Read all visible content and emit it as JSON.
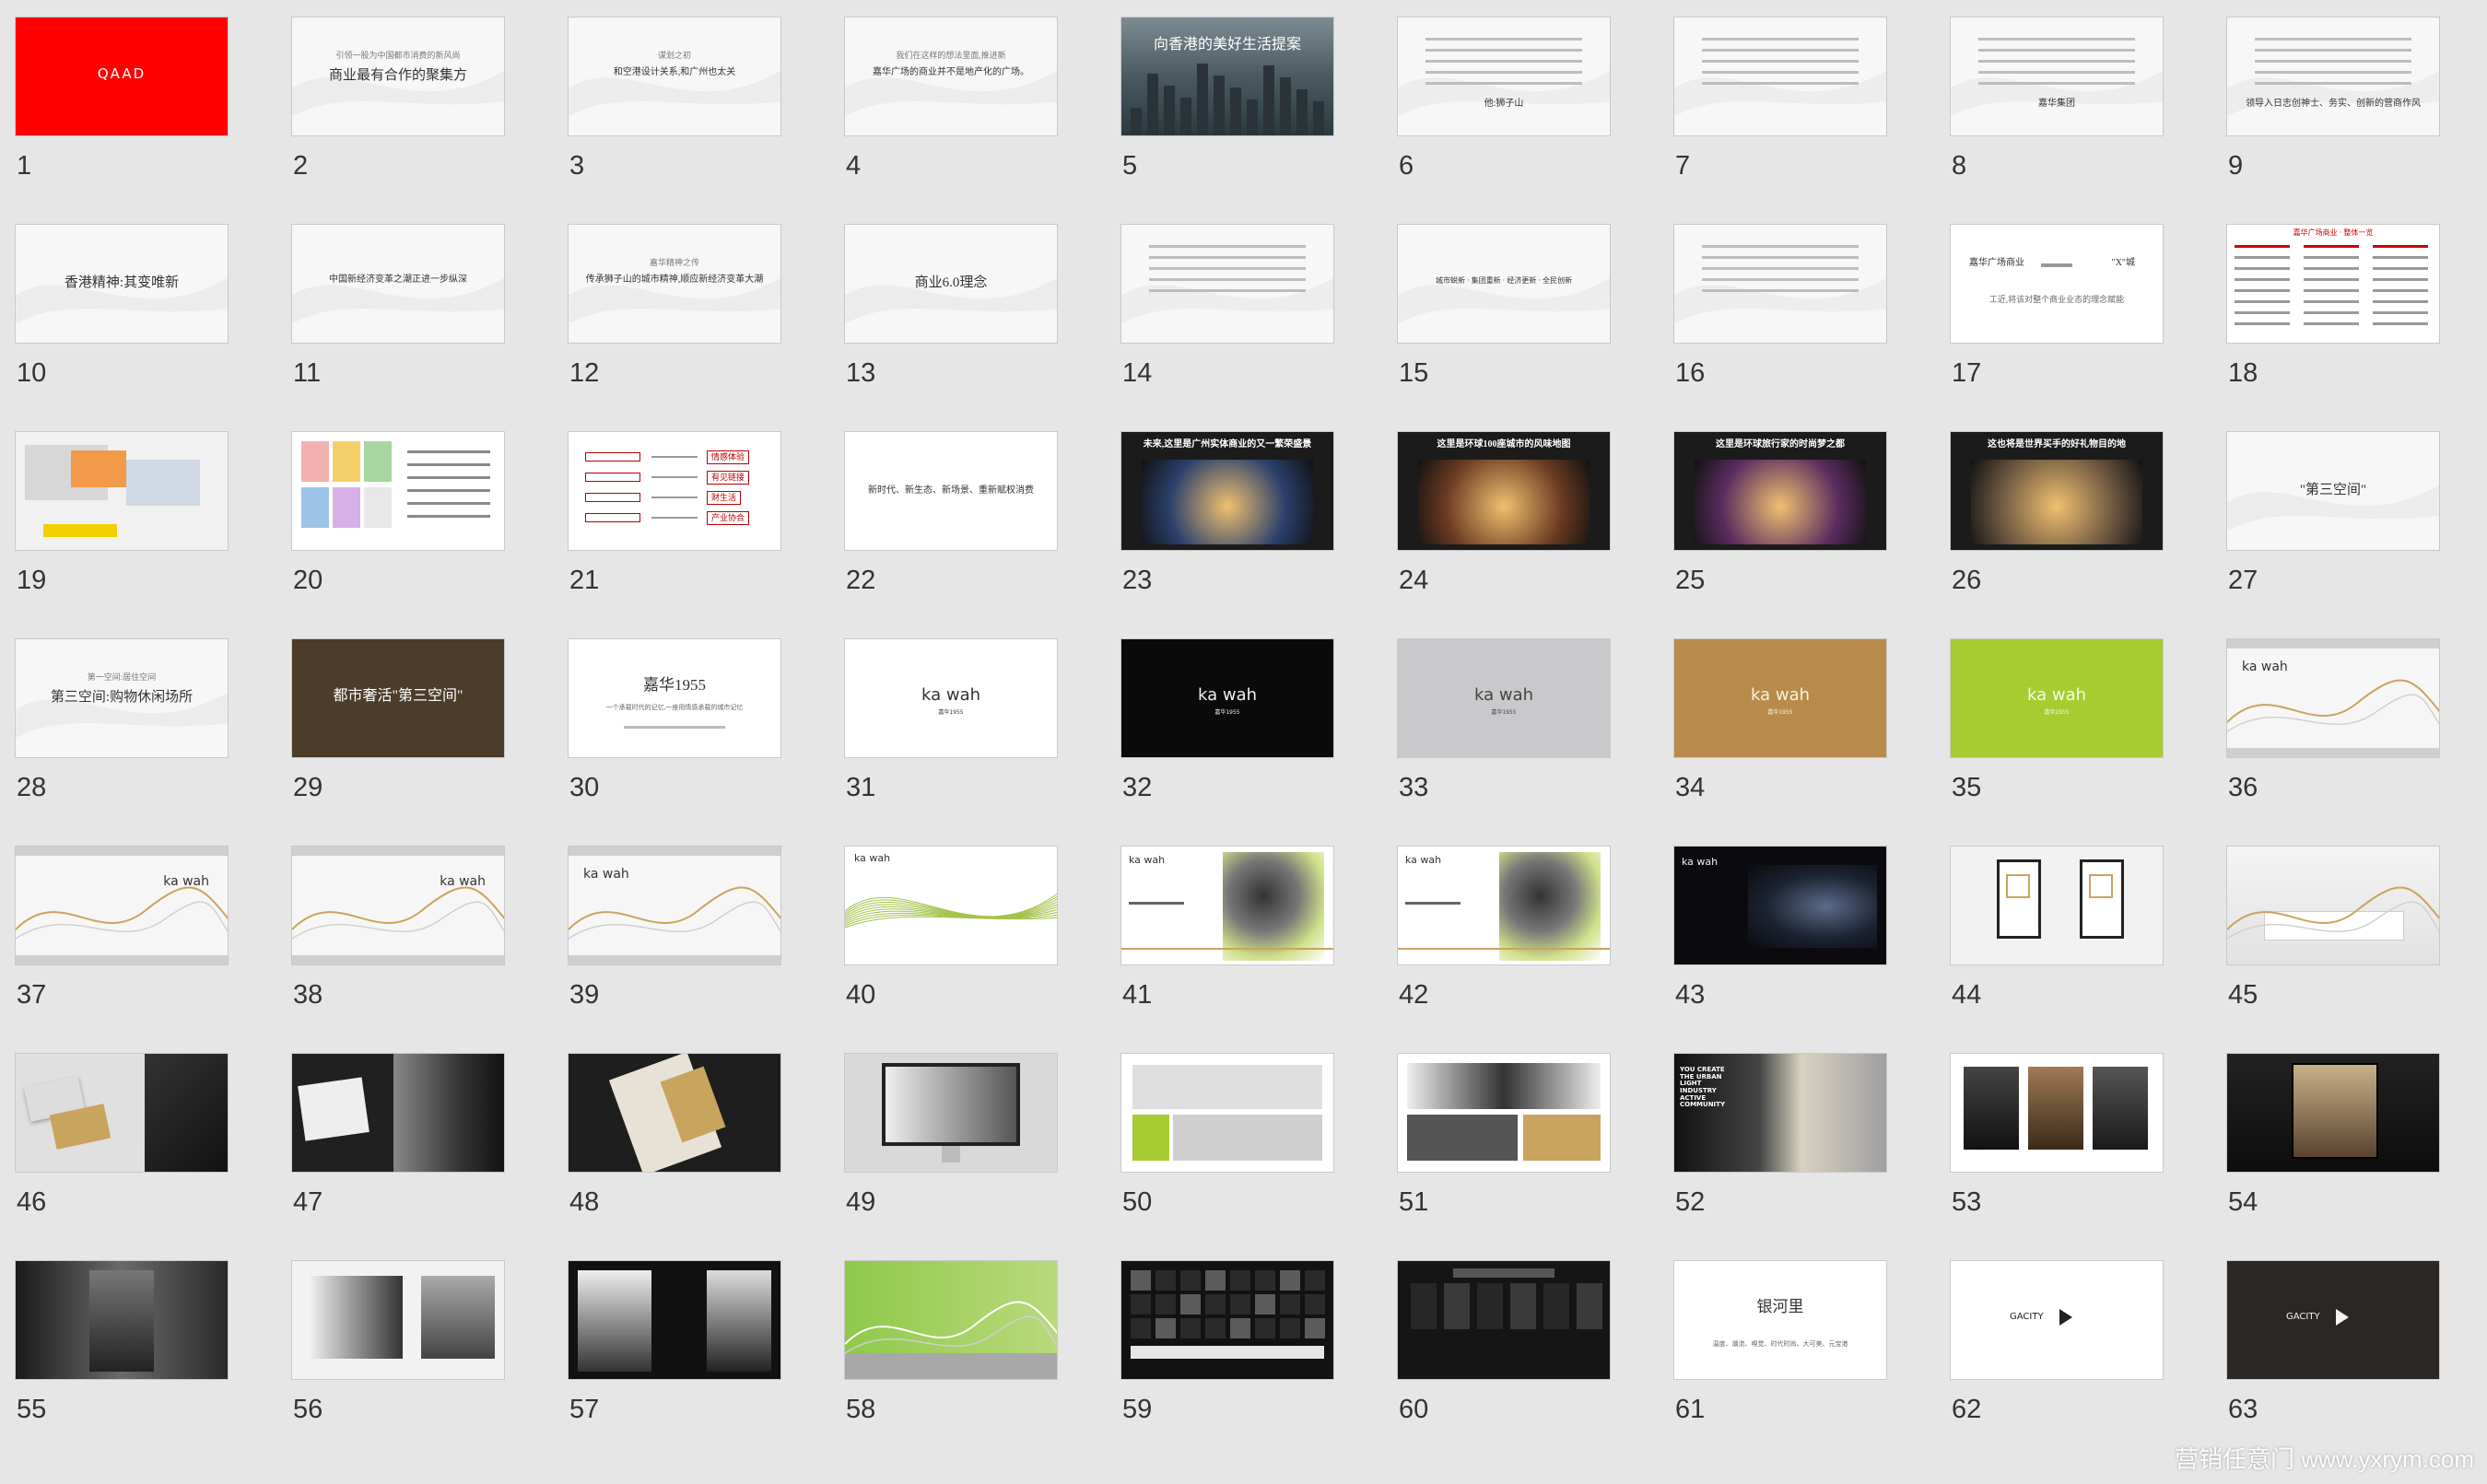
{
  "slides": [
    {
      "num": "1",
      "v": "red_logo",
      "logo": "QAAD",
      "bg": "#ff0000"
    },
    {
      "num": "2",
      "v": "wave",
      "sub": "引领一股为中国都市消费的新风尚",
      "title": "商业最有合作的聚集方"
    },
    {
      "num": "3",
      "v": "wave",
      "sub": "谋划之初",
      "title": "和空港设计关系,和广州也太关"
    },
    {
      "num": "4",
      "v": "wave",
      "sub": "我们在这样的想法里面,推进新",
      "title": "嘉华广场的商业并不是地产化的广场。"
    },
    {
      "num": "5",
      "v": "city",
      "title": "向香港的美好生活提案",
      "bg": "#3a4a55"
    },
    {
      "num": "6",
      "v": "wave_text",
      "title": "他:狮子山"
    },
    {
      "num": "7",
      "v": "wave_text",
      "title": ""
    },
    {
      "num": "8",
      "v": "wave_text",
      "title": "嘉华集团"
    },
    {
      "num": "9",
      "v": "wave_text",
      "title": "领导入日志创神士、务实、创新的营商作风"
    },
    {
      "num": "10",
      "v": "wave",
      "sub": "",
      "title": "香港精神:其变唯新"
    },
    {
      "num": "11",
      "v": "wave",
      "sub": "",
      "title": "中国新经济变革之潮正进一步纵深"
    },
    {
      "num": "12",
      "v": "wave",
      "sub": "嘉华精神之传",
      "title": "传承狮子山的城市精神,顺应新经济变革大潮"
    },
    {
      "num": "13",
      "v": "wave",
      "sub": "",
      "title": "商业6.0理念"
    },
    {
      "num": "14",
      "v": "wave_text",
      "title": ""
    },
    {
      "num": "15",
      "v": "wave_list",
      "title": "城市蜕新 · 集团重新 · 经济更新 · 全民创新"
    },
    {
      "num": "16",
      "v": "wave_text",
      "title": ""
    },
    {
      "num": "17",
      "v": "arrow",
      "left": "嘉华广场商业",
      "right": "\"X\"城",
      "title": "工近,将该对整个商业业态的理念赋能"
    },
    {
      "num": "18",
      "v": "table",
      "title": "嘉华广场商业 · 整体一览"
    },
    {
      "num": "19",
      "v": "map",
      "title": ""
    },
    {
      "num": "20",
      "v": "plan",
      "title": ""
    },
    {
      "num": "21",
      "v": "flow",
      "labels": [
        "情感体验",
        "有见链接",
        "财生活",
        "产业协合"
      ]
    },
    {
      "num": "22",
      "v": "plain",
      "title": "新时代、新生态、新场景、重新赋权消费"
    },
    {
      "num": "23",
      "v": "dark_photo",
      "title": "未来,这里是广州实体商业的又一繁荣盛景",
      "photo": "#2a3f6b"
    },
    {
      "num": "24",
      "v": "dark_photo",
      "title": "这里是环球100座城市的风味地图",
      "photo": "#6b3a22"
    },
    {
      "num": "25",
      "v": "dark_photo",
      "title": "这里是环球旅行家的时尚梦之都",
      "photo": "#5a2c5f"
    },
    {
      "num": "26",
      "v": "dark_photo",
      "title": "这也将是世界买手的好礼物目的地",
      "photo": "#6a5540"
    },
    {
      "num": "27",
      "v": "wave",
      "sub": "",
      "title": "\"第三空间\""
    },
    {
      "num": "28",
      "v": "wave",
      "sub": "第一空间:居住空间",
      "title": "第三空间:购物休闲场所"
    },
    {
      "num": "29",
      "v": "brown",
      "title": "都市奢活\"第三空间\"",
      "bg": "#4c3c2a"
    },
    {
      "num": "30",
      "v": "plain2",
      "title": "嘉华1955",
      "sub": "一个承载时代的记忆,一座用情感承载的城市记忆"
    },
    {
      "num": "31",
      "v": "logo",
      "bg": "#ffffff",
      "fg": "#333333",
      "logo": "ka wah",
      "tag": "嘉华1955"
    },
    {
      "num": "32",
      "v": "logo",
      "bg": "#0a0a0a",
      "fg": "#f0f0f0",
      "logo": "ka wah",
      "tag": "嘉华1955"
    },
    {
      "num": "33",
      "v": "logo",
      "bg": "#c9c9cc",
      "fg": "#444444",
      "logo": "ka wah",
      "tag": "嘉华1955"
    },
    {
      "num": "34",
      "v": "logo",
      "bg": "#b88b4a",
      "fg": "#f7f1e6",
      "logo": "ka wah",
      "tag": "嘉华1955"
    },
    {
      "num": "35",
      "v": "logo",
      "bg": "#a6cc32",
      "fg": "#f5fae6",
      "logo": "ka wah",
      "tag": "嘉华1955"
    },
    {
      "num": "36",
      "v": "curve_logo",
      "logo": "ka wah",
      "pos": "left"
    },
    {
      "num": "37",
      "v": "curve_logo",
      "logo": "ka wah",
      "pos": "right"
    },
    {
      "num": "38",
      "v": "curve_logo",
      "logo": "ka wah",
      "pos": "right"
    },
    {
      "num": "39",
      "v": "curve_logo",
      "logo": "ka wah",
      "pos": "left"
    },
    {
      "num": "40",
      "v": "green_wave",
      "logo": "ka wah"
    },
    {
      "num": "41",
      "v": "art",
      "logo": "ka wah"
    },
    {
      "num": "42",
      "v": "art",
      "logo": "ka wah"
    },
    {
      "num": "43",
      "v": "dark_art",
      "logo": "ka wah"
    },
    {
      "num": "44",
      "v": "signs"
    },
    {
      "num": "45",
      "v": "office"
    },
    {
      "num": "46",
      "v": "cards"
    },
    {
      "num": "47",
      "v": "cards2"
    },
    {
      "num": "48",
      "v": "cards3"
    },
    {
      "num": "49",
      "v": "monitor"
    },
    {
      "num": "50",
      "v": "layout"
    },
    {
      "num": "51",
      "v": "layout2"
    },
    {
      "num": "52",
      "v": "billboard",
      "text": "YOU CREATE THE URBAN LIGHT INDUSTRY ACTIVE COMMUNITY"
    },
    {
      "num": "53",
      "v": "posters"
    },
    {
      "num": "54",
      "v": "lightbox"
    },
    {
      "num": "55",
      "v": "mall"
    },
    {
      "num": "56",
      "v": "wall_art"
    },
    {
      "num": "57",
      "v": "fashion"
    },
    {
      "num": "58",
      "v": "green_wall"
    },
    {
      "num": "59",
      "v": "store_front"
    },
    {
      "num": "60",
      "v": "store_front2"
    },
    {
      "num": "61",
      "v": "plain2",
      "title": "银河里",
      "sub": "",
      "small": "温度、潮流、嗅觉、时代时尚、大可美、元宝港"
    },
    {
      "num": "62",
      "v": "gacity",
      "bg": "#ffffff",
      "fg": "#222222",
      "logo": "GACITY"
    },
    {
      "num": "63",
      "v": "gacity",
      "bg": "#2b2724",
      "fg": "#f5f5f5",
      "logo": "GACITY"
    }
  ],
  "watermark": "营销任意门 www.yxrym.com"
}
